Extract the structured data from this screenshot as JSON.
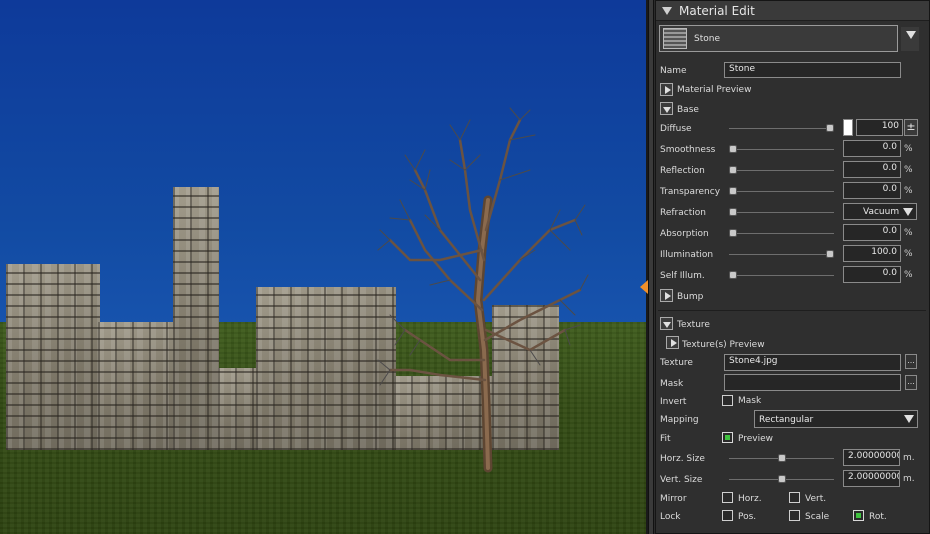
{
  "panel": {
    "title": "Material Edit",
    "material_selector": "Stone",
    "name_label": "Name",
    "name_value": "Stone",
    "material_preview_label": "Material Preview",
    "base_label": "Base",
    "diffuse": {
      "label": "Diffuse",
      "value": "100",
      "level": 1.0,
      "spin": "±",
      "swatch_color": "#ffffff"
    },
    "smoothness": {
      "label": "Smoothness",
      "value": "0.0",
      "unit": "%",
      "level": 0.0
    },
    "reflection": {
      "label": "Reflection",
      "value": "0.0",
      "unit": "%",
      "level": 0.0
    },
    "transparency": {
      "label": "Transparency",
      "value": "0.0",
      "unit": "%",
      "level": 0.0
    },
    "refraction": {
      "label": "Refraction",
      "value": "Vacuum",
      "level": 0.0
    },
    "absorption": {
      "label": "Absorption",
      "value": "0.0",
      "unit": "%",
      "level": 0.0
    },
    "illumination": {
      "label": "Illumination",
      "value": "100.0",
      "unit": "%",
      "level": 1.0
    },
    "self_illum": {
      "label": "Self Illum.",
      "value": "0.0",
      "unit": "%",
      "level": 0.0
    },
    "bump_label": "Bump",
    "texture_section_label": "Texture",
    "textures_preview_label": "Texture(s) Preview",
    "texture_label": "Texture",
    "texture_value": "Stone4.jpg",
    "mask_label": "Mask",
    "mask_value": "",
    "browse_label": "...",
    "invert_label": "Invert",
    "invert_mask_label": "Mask",
    "invert_mask_checked": false,
    "mapping_label": "Mapping",
    "mapping_value": "Rectangular",
    "fit_label": "Fit",
    "fit_preview_label": "Preview",
    "fit_preview_checked": true,
    "horz_size": {
      "label": "Horz. Size",
      "value": "2.00000000",
      "unit": "m.",
      "level": 0.5
    },
    "vert_size": {
      "label": "Vert. Size",
      "value": "2.00000000",
      "unit": "m.",
      "level": 0.5
    },
    "mirror_label": "Mirror",
    "mirror_horz_label": "Horz.",
    "mirror_vert_label": "Vert.",
    "lock_label": "Lock",
    "lock_pos_label": "Pos.",
    "lock_scale_label": "Scale",
    "lock_rot_label": "Rot.",
    "lock_rot_checked": true
  },
  "colors": {
    "sky": "#124ba3",
    "ground": "#3a5519",
    "stone": "#8e8878",
    "panel_bg": "#2f2f2f",
    "check_green": "#3fc23f",
    "handle_orange": "#f0902a"
  }
}
